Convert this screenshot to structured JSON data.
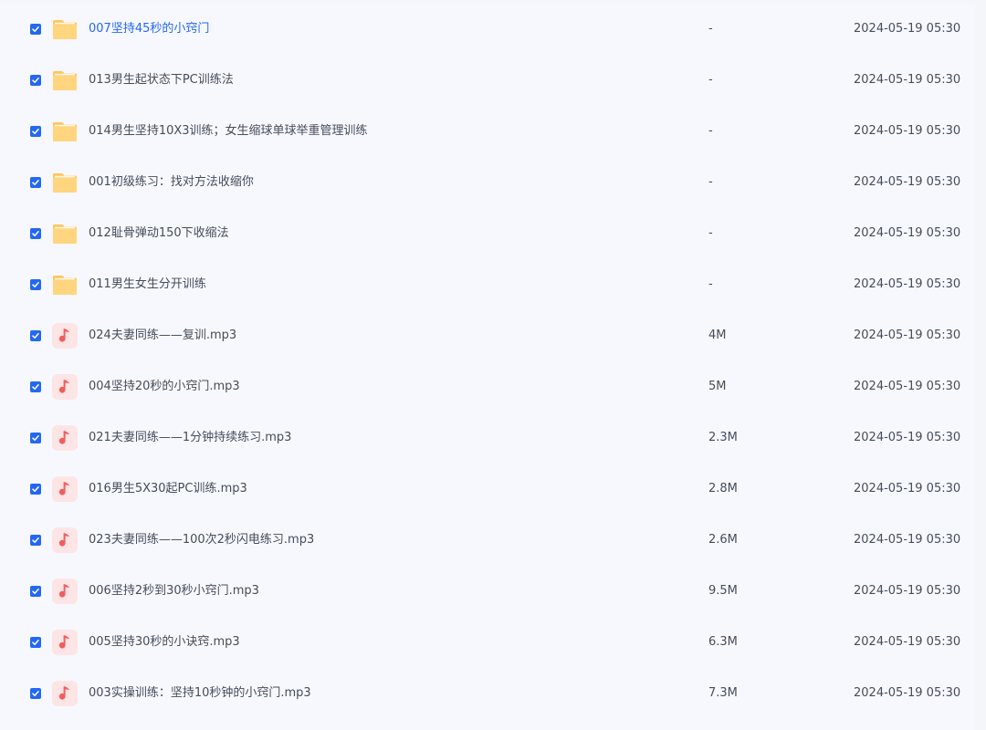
{
  "colors": {
    "accent": "#2468f2",
    "text": "#454d5a",
    "folder": "#ffc65c",
    "audio_bg": "#fde5e6",
    "audio_note": "#f25d5d"
  },
  "files": [
    {
      "name": "007坚持45秒的小窍门",
      "size": "-",
      "date": "2024-05-19 05:30",
      "type": "folder",
      "icon": "folder-icon",
      "checked": true
    },
    {
      "name": "013男生起状态下PC训练法",
      "size": "-",
      "date": "2024-05-19 05:30",
      "type": "folder",
      "icon": "folder-icon",
      "checked": true
    },
    {
      "name": "014男生坚持10X3训练；女生缩球单球举重管理训练",
      "size": "-",
      "date": "2024-05-19 05:30",
      "type": "folder",
      "icon": "folder-icon",
      "checked": true
    },
    {
      "name": "001初级练习：找对方法收缩你",
      "size": "-",
      "date": "2024-05-19 05:30",
      "type": "folder",
      "icon": "folder-icon",
      "checked": true
    },
    {
      "name": "012耻骨弹动150下收缩法",
      "size": "-",
      "date": "2024-05-19 05:30",
      "type": "folder",
      "icon": "folder-icon",
      "checked": true
    },
    {
      "name": "011男生女生分开训练",
      "size": "-",
      "date": "2024-05-19 05:30",
      "type": "folder",
      "icon": "folder-icon",
      "checked": true
    },
    {
      "name": "024夫妻同练——复训.mp3",
      "size": "4M",
      "date": "2024-05-19 05:30",
      "type": "audio",
      "icon": "music-note-icon",
      "checked": true
    },
    {
      "name": "004坚持20秒的小窍门.mp3",
      "size": "5M",
      "date": "2024-05-19 05:30",
      "type": "audio",
      "icon": "music-note-icon",
      "checked": true
    },
    {
      "name": "021夫妻同练——1分钟持续练习.mp3",
      "size": "2.3M",
      "date": "2024-05-19 05:30",
      "type": "audio",
      "icon": "music-note-icon",
      "checked": true
    },
    {
      "name": "016男生5X30起PC训练.mp3",
      "size": "2.8M",
      "date": "2024-05-19 05:30",
      "type": "audio",
      "icon": "music-note-icon",
      "checked": true
    },
    {
      "name": "023夫妻同练——100次2秒闪电练习.mp3",
      "size": "2.6M",
      "date": "2024-05-19 05:30",
      "type": "audio",
      "icon": "music-note-icon",
      "checked": true
    },
    {
      "name": "006坚持2秒到30秒小窍门.mp3",
      "size": "9.5M",
      "date": "2024-05-19 05:30",
      "type": "audio",
      "icon": "music-note-icon",
      "checked": true
    },
    {
      "name": "005坚持30秒的小诀窍.mp3",
      "size": "6.3M",
      "date": "2024-05-19 05:30",
      "type": "audio",
      "icon": "music-note-icon",
      "checked": true
    },
    {
      "name": "003实操训练：坚持10秒钟的小窍门.mp3",
      "size": "7.3M",
      "date": "2024-05-19 05:30",
      "type": "audio",
      "icon": "music-note-icon",
      "checked": true
    }
  ]
}
